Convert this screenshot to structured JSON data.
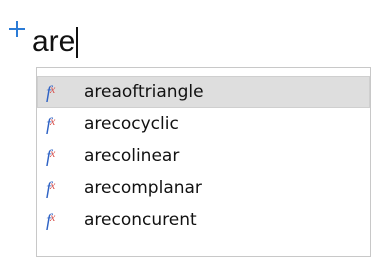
{
  "editor": {
    "typed_text": "are"
  },
  "autocomplete": {
    "items": [
      {
        "label": "areaoftriangle",
        "icon": "function-icon",
        "selected": true
      },
      {
        "label": "arecocyclic",
        "icon": "function-icon",
        "selected": false
      },
      {
        "label": "arecolinear",
        "icon": "function-icon",
        "selected": false
      },
      {
        "label": "arecomplanar",
        "icon": "function-icon",
        "selected": false
      },
      {
        "label": "areconcurent",
        "icon": "function-icon",
        "selected": false
      }
    ]
  },
  "colors": {
    "plus": "#2b7bd6",
    "fx_glyph": "#2f63c5",
    "selection_bg": "#dedede"
  }
}
